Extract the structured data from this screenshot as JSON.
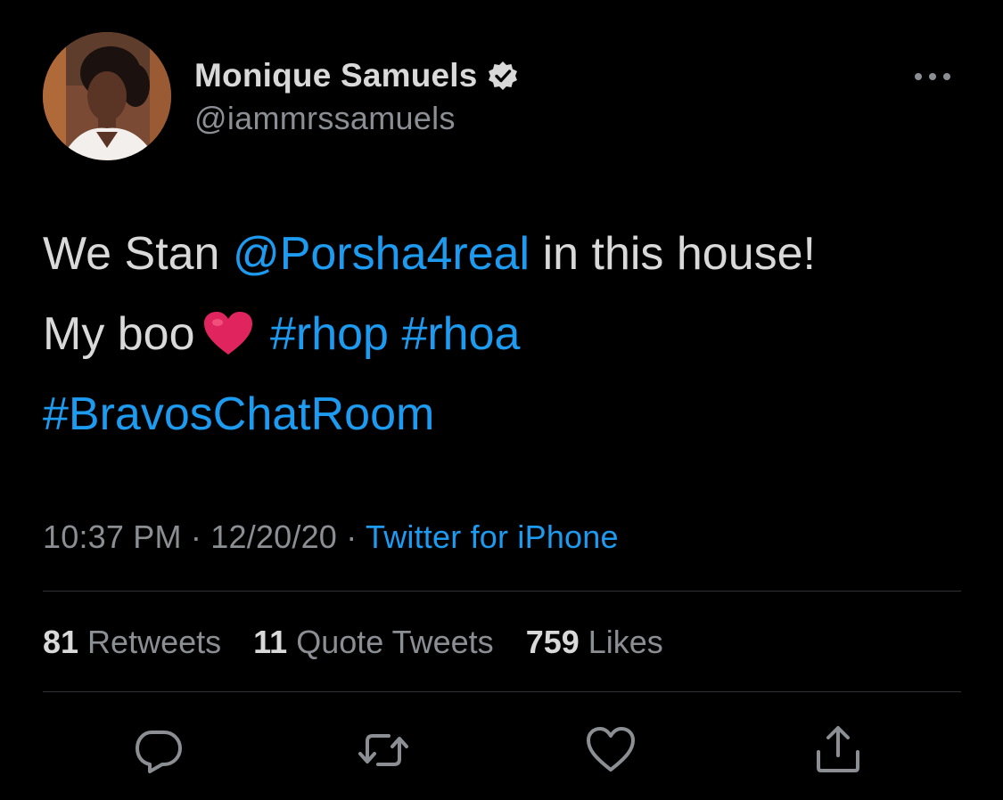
{
  "user": {
    "display_name": "Monique Samuels",
    "handle": "@iammrssamuels",
    "verified_icon": "verified-badge-icon",
    "avatar_icon": "profile-photo-avatar"
  },
  "tweet": {
    "segments": [
      {
        "text": "We Stan ",
        "type": "text"
      },
      {
        "text": "@Porsha4real",
        "type": "mention"
      },
      {
        "text": " in this house!",
        "type": "text"
      },
      {
        "text": "My boo",
        "type": "text"
      },
      {
        "text": "❤️",
        "type": "emoji"
      },
      {
        "text": "#rhop",
        "type": "hashtag"
      },
      {
        "text": "#rhoa",
        "type": "hashtag"
      },
      {
        "text": "#BravosChatRoom",
        "type": "hashtag"
      }
    ]
  },
  "meta": {
    "time": "10:37 PM",
    "separator": " · ",
    "date": "12/20/20",
    "source": "Twitter for iPhone"
  },
  "stats": {
    "retweets_count": "81",
    "retweets_label": "Retweets",
    "quotes_count": "11",
    "quotes_label": "Quote Tweets",
    "likes_count": "759",
    "likes_label": "Likes"
  },
  "actions": [
    "reply-icon",
    "retweet-icon",
    "like-icon",
    "share-icon"
  ],
  "colors": {
    "background": "#000000",
    "text": "#d9d9d9",
    "secondary": "#8b8f94",
    "link": "#1d9bf0",
    "divider": "#2f3336",
    "heart": "#e0245e"
  }
}
